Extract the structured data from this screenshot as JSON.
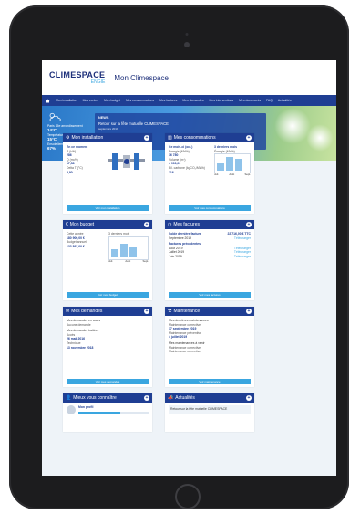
{
  "header": {
    "logo": "CLIMESPACE",
    "logo_sub": "ENGIE",
    "title": "Mon Climespace"
  },
  "nav": {
    "items": [
      "Mon installation",
      "Mes ventes",
      "Mon budget",
      "Mes consommations",
      "Mes factures",
      "Mes demandes",
      "Mes interventions",
      "Mes documents",
      "FAQ",
      "Actualités"
    ]
  },
  "weather": {
    "location": "Paris 15e arrondissement",
    "temp": "14°C",
    "label2": "Température ressentie",
    "temp2": "15°C",
    "label3": "Ensoleillement",
    "pct": "67%"
  },
  "news": {
    "head": "NEWS",
    "title": "Retour sur la fête mutuelle CLIMESPACE",
    "date": "septembre 2019",
    "button": "En savoir plus"
  },
  "cards": {
    "installation": {
      "title": "Mon installation",
      "status": "En ce moment",
      "l1": "P (kW)",
      "v1": "286",
      "l2": "Q (m³/h)",
      "v2": "17,58",
      "l3": "Delta T (°C)",
      "v3": "5,90",
      "footer": "Voir mon installation"
    },
    "consommations": {
      "title": "Mes consommations",
      "c1": "Ce mois-ci (oct.)",
      "c2": "3 derniers mois",
      "l1": "Énergie (MWh)",
      "v1": "16 780",
      "l2": "Volume (m³)",
      "v2": "4 900,00",
      "l3": "Bil. carbone (kgCO₂/MWh)",
      "v3": "216",
      "l4": "Énergie (MWh)",
      "bars": [
        0.55,
        0.95,
        0.8
      ],
      "months": [
        "Juil.",
        "Août",
        "Sept."
      ],
      "footer": "Voir mes consommations"
    },
    "budget": {
      "title": "Mon budget",
      "l1": "Cette année",
      "v1": "180 900,00 €",
      "l2": "Budget annuel",
      "v2": "133 897,00 €",
      "chart_label": "3 derniers mois",
      "bars": [
        0.45,
        0.75,
        0.6
      ],
      "months": [
        "Juil.",
        "Août",
        "Sept."
      ],
      "footer": "Voir mon budget"
    },
    "factures": {
      "title": "Mes factures",
      "solde_label": "Solde dernière facture",
      "solde": "22 716,00 € TTC",
      "solde_date": "Septembre 2019",
      "link": "Télécharger",
      "prev_title": "Factures précédentes",
      "prev": [
        "Août 2019",
        "Juillet 2019",
        "Juin 2019"
      ],
      "footer": "Voir mes factures"
    },
    "demandes": {
      "title": "Mes demandes",
      "l1": "Mes demandes en cours",
      "v1": "Aucune demande",
      "l2": "Mes demandes traitées",
      "v2": "Accès",
      "d2": "26 mail 2016",
      "l3": "Technique",
      "d3": "13 novembre 2018",
      "footer": "Voir mes demandes"
    },
    "maintenance": {
      "title": "Maintenance",
      "l1": "Mes dernières maintenances",
      "v1": "Maintenance corrective",
      "d1": "17 septembre 2019",
      "l2": "Maintenance préventive",
      "d2": "4 juillet 2019",
      "l3": "Mes maintenances à venir",
      "v3": "Maintenance corrective",
      "v4": "Maintenance corrective",
      "footer": "Voir maintenance"
    },
    "profil": {
      "title": "Mieux vous connaître",
      "label": "Mon profil",
      "progress": 0.6
    },
    "actualites": {
      "title": "Actualités",
      "text": "Retour sur la fête mutuelle CLIMESPACE"
    }
  },
  "colors": {
    "navy": "#1f3e93",
    "accent": "#3aa6e0",
    "bar": "#8fc3ea"
  }
}
